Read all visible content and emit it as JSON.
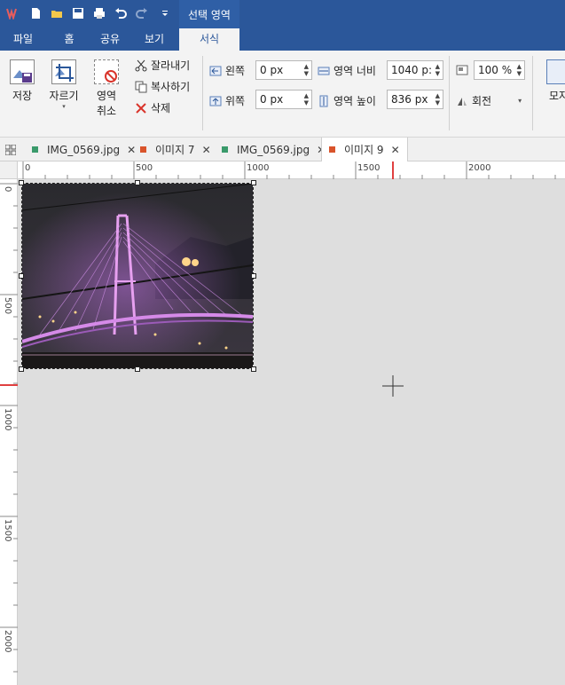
{
  "titlebar": {
    "context_label": "선택 영역",
    "quick_access": [
      "app-logo-icon",
      "new-icon",
      "open-icon",
      "save-icon",
      "print-icon",
      "undo-icon",
      "redo-icon",
      "customize-icon"
    ]
  },
  "menu": {
    "tabs": [
      "파일",
      "홈",
      "공유",
      "보기",
      "서식"
    ],
    "active": "서식"
  },
  "ribbon": {
    "save_label": "저장",
    "crop_label": "자르기",
    "cancel_area_label_1": "영역",
    "cancel_area_label_2": "취소",
    "cut_label": "잘라내기",
    "copy_label": "복사하기",
    "delete_label": "삭제",
    "left_label": "왼쪽",
    "left_value": "0 px",
    "top_label": "위쪽",
    "top_value": "0 px",
    "width_label": "영역 너비",
    "width_value": "1040 p:",
    "height_label": "영역 높이",
    "height_value": "836 px",
    "zoom_value": "100 %",
    "rotate_label": "회전",
    "mosaic_label": "모자"
  },
  "doc_tabs": [
    {
      "label": "IMG_0569.jpg",
      "color": "#3a9a6b",
      "active": false
    },
    {
      "label": "이미지 7",
      "color": "#d9542b",
      "active": false
    },
    {
      "label": "IMG_0569.jpg",
      "color": "#3a9a6b",
      "active": false
    },
    {
      "label": "이미지 9",
      "color": "#d9542b",
      "active": true
    }
  ],
  "rulers": {
    "h_labels": [
      "0",
      "500",
      "1000",
      "1500",
      "2000"
    ],
    "v_labels": [
      "0",
      "500",
      "1000",
      "1500",
      "2000"
    ],
    "marker_color": "#e04040"
  },
  "accent": "#2b579a"
}
